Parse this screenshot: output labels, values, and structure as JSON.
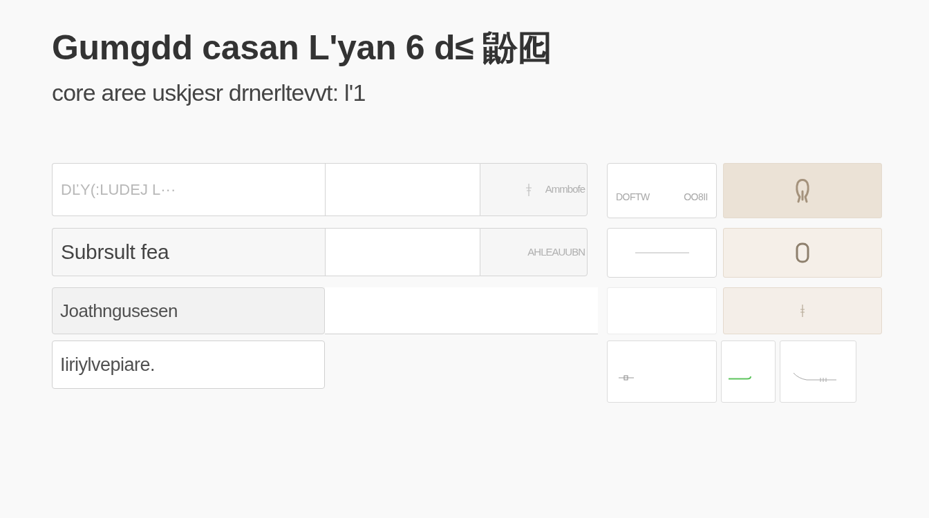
{
  "title": "Gumgdd casan L'yan 6 d≤ 鼢囮",
  "subtitle": "core aree uskjesr drnerltevvt: l'1",
  "form_rows": [
    {
      "kind": "split",
      "field": {
        "placeholder": "DĽY(:LUDEJ L···"
      },
      "column_3": {
        "kind": "with_icon",
        "text": "Ammbofe"
      }
    },
    {
      "kind": "split",
      "field": {
        "value": "Subrsult fea"
      },
      "column_3": {
        "kind": "plain",
        "text": "AHLEAUUBN"
      }
    },
    {
      "kind": "wide",
      "field": {
        "value": "Joathngusesen"
      }
    },
    {
      "kind": "single",
      "field": {
        "value": "Iiriylvepiare."
      }
    }
  ],
  "tile_rows": [
    {
      "tiles": [
        {
          "kind": "labels",
          "texts": [
            "DOFTW",
            "OO8II"
          ]
        },
        {
          "kind": "accent",
          "color": "#ebe2d6"
        }
      ]
    },
    {
      "tiles": [
        {
          "kind": "rule"
        },
        {
          "kind": "accent",
          "color": "#f5efe8"
        }
      ]
    },
    {
      "tiles": [
        {
          "kind": "blank"
        },
        {
          "kind": "accent",
          "color": "#f4eee8"
        }
      ]
    },
    {
      "tiles": [
        {
          "kind": "sketch"
        },
        {
          "kind": "sketch"
        },
        {
          "kind": "sketch"
        }
      ]
    }
  ]
}
